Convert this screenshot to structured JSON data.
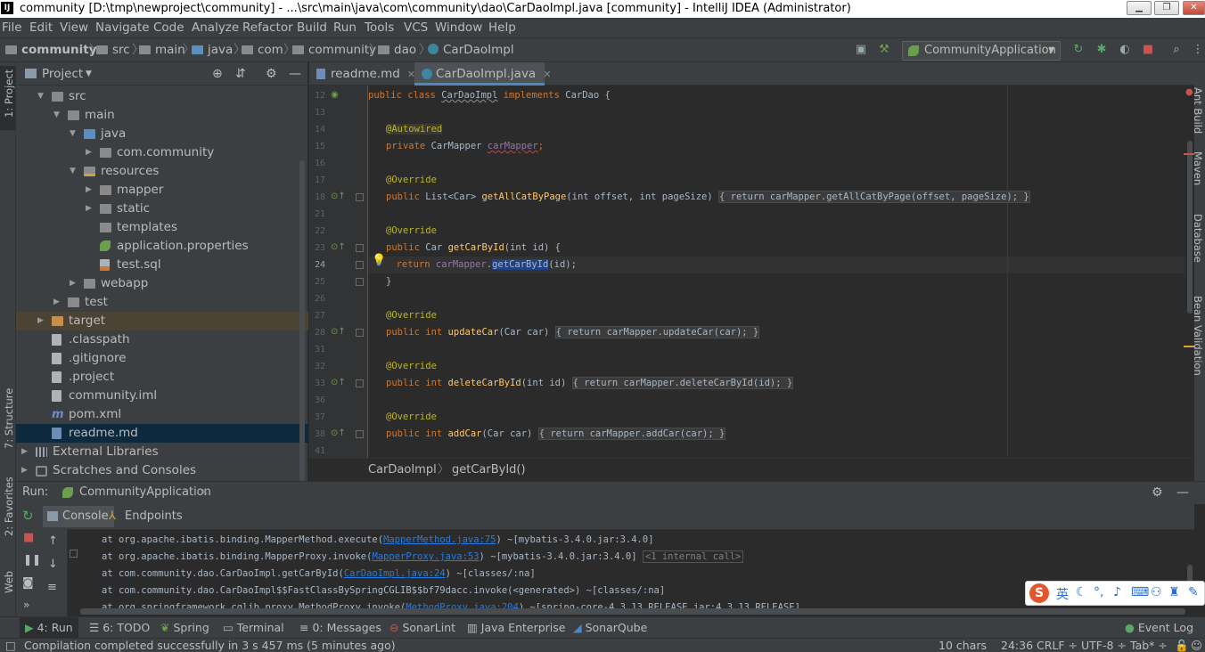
{
  "window": {
    "title": "community [D:\\tmp\\newproject\\community] - ...\\src\\main\\java\\com\\community\\dao\\CarDaoImpl.java [community] - IntelliJ IDEA (Administrator)",
    "app_icon": "IJ"
  },
  "menu": [
    "File",
    "Edit",
    "View",
    "Navigate",
    "Code",
    "Analyze",
    "Refactor",
    "Build",
    "Run",
    "Tools",
    "VCS",
    "Window",
    "Help"
  ],
  "breadcrumb": [
    "community",
    "src",
    "main",
    "java",
    "com",
    "community",
    "dao",
    "CarDaoImpl"
  ],
  "run_config": "CommunityApplication",
  "left_stripe": {
    "project": "1: Project",
    "structure": "7: Structure",
    "favorites": "2: Favorites",
    "web": "Web"
  },
  "right_stripe": {
    "ant": "Ant Build",
    "maven": "Maven",
    "database": "Database",
    "bean": "Bean Validation"
  },
  "project_panel": {
    "title": "Project",
    "tree": [
      {
        "label": "src",
        "depth": 1,
        "arrow": "open",
        "icon": "grey"
      },
      {
        "label": "main",
        "depth": 2,
        "arrow": "open",
        "icon": "grey"
      },
      {
        "label": "java",
        "depth": 3,
        "arrow": "open",
        "icon": "blue"
      },
      {
        "label": "com.community",
        "depth": 4,
        "arrow": "closed",
        "icon": "grey"
      },
      {
        "label": "resources",
        "depth": 3,
        "arrow": "open",
        "icon": "res"
      },
      {
        "label": "mapper",
        "depth": 4,
        "arrow": "closed",
        "icon": "grey"
      },
      {
        "label": "static",
        "depth": 4,
        "arrow": "closed",
        "icon": "grey"
      },
      {
        "label": "templates",
        "depth": 4,
        "arrow": "none",
        "icon": "grey"
      },
      {
        "label": "application.properties",
        "depth": 4,
        "arrow": "none",
        "icon": "leaf"
      },
      {
        "label": "test.sql",
        "depth": 4,
        "arrow": "none",
        "icon": "sql"
      },
      {
        "label": "webapp",
        "depth": 3,
        "arrow": "closed",
        "icon": "grey"
      },
      {
        "label": "test",
        "depth": 2,
        "arrow": "closed",
        "icon": "grey"
      },
      {
        "label": "target",
        "depth": 1,
        "arrow": "closed",
        "icon": "orange",
        "state": "hl"
      },
      {
        "label": ".classpath",
        "depth": 1,
        "arrow": "none",
        "icon": "file"
      },
      {
        "label": ".gitignore",
        "depth": 1,
        "arrow": "none",
        "icon": "file"
      },
      {
        "label": ".project",
        "depth": 1,
        "arrow": "none",
        "icon": "file"
      },
      {
        "label": "community.iml",
        "depth": 1,
        "arrow": "none",
        "icon": "file"
      },
      {
        "label": "pom.xml",
        "depth": 1,
        "arrow": "none",
        "icon": "m"
      },
      {
        "label": "readme.md",
        "depth": 1,
        "arrow": "none",
        "icon": "md",
        "state": "sel"
      },
      {
        "label": "External Libraries",
        "depth": 0,
        "arrow": "closed",
        "icon": "lib"
      },
      {
        "label": "Scratches and Consoles",
        "depth": 0,
        "arrow": "closed",
        "icon": "scratch"
      }
    ]
  },
  "editor": {
    "tabs": [
      {
        "label": "readme.md",
        "active": false
      },
      {
        "label": "CarDaoImpl.java",
        "active": true
      }
    ],
    "line_numbers": [
      "12",
      "13",
      "14",
      "15",
      "16",
      "17",
      "18",
      "21",
      "22",
      "23",
      "24",
      "25",
      "26",
      "27",
      "28",
      "31",
      "32",
      "33",
      "36",
      "37",
      "38",
      "41"
    ],
    "current_line": "24",
    "code": {
      "class_decl": {
        "k1": "public class ",
        "name": "CarDaoImpl",
        "k2": " implements ",
        "iface": "CarDao {"
      },
      "autowired": "@Autowired",
      "field": {
        "k": "private ",
        "type": "CarMapper ",
        "name": "carMapper",
        "end": ";"
      },
      "override": "@Override",
      "m1": {
        "k": "public ",
        "ret": "List<Car> ",
        "name": "getAllCatByPage",
        "params": "(int offset, int pageSize) ",
        "body": "{ return carMapper.getAllCatByPage(offset, pageSize); }"
      },
      "m2": {
        "k": "public ",
        "ret": "Car ",
        "name": "getCarById",
        "params": "(int id) {"
      },
      "m2_body": {
        "k": "return ",
        "field": "carMapper",
        "dot": ".",
        "call": "getCarById",
        "args": "(id);"
      },
      "close_brace": "}",
      "m3": {
        "k": "public int ",
        "name": "updateCar",
        "params": "(Car car) ",
        "body": "{ return carMapper.updateCar(car); }"
      },
      "m4": {
        "k": "public int ",
        "name": "deleteCarById",
        "params": "(int id) ",
        "body": "{ return carMapper.deleteCarById(id); }"
      },
      "m5": {
        "k": "public int ",
        "name": "addCar",
        "params": "(Car car) ",
        "body": "{ return carMapper.addCar(car); }"
      }
    },
    "breadcrumb": [
      "CarDaoImpl",
      "getCarById()"
    ]
  },
  "run_panel": {
    "label": "Run:",
    "config": "CommunityApplication",
    "tabs": [
      "Console",
      "Endpoints"
    ],
    "lines": [
      {
        "pre": "at org.apache.ibatis.binding.MapperMethod.execute(",
        "link": "MapperMethod.java:75",
        "post": ") ~[mybatis-3.4.0.jar:3.4.0]",
        "extra": ""
      },
      {
        "pre": "at org.apache.ibatis.binding.MapperProxy.invoke(",
        "link": "MapperProxy.java:53",
        "post": ") ~[mybatis-3.4.0.jar:3.4.0] ",
        "extra": "<1 internal call>"
      },
      {
        "pre": "at com.community.dao.CarDaoImpl.getCarById(",
        "link": "CarDaoImpl.java:24",
        "post": ") ~[classes/:na]",
        "extra": ""
      },
      {
        "pre": "at com.community.dao.CarDaoImpl$$FastClassBySpringCGLIB$$bf79dacc.invoke(<generated>) ~[classes/:na]",
        "link": "",
        "post": "",
        "extra": ""
      },
      {
        "pre": "at org.springframework.cglib.proxy.MethodProxy.invoke(",
        "link": "MethodProxy.java:204",
        "post": ") ~[spring-core-4.3.13.RELEASE.jar:4.3.13.RELEASE]",
        "extra": ""
      }
    ]
  },
  "bottom_tabs": [
    "4: Run",
    "6: TODO",
    "Spring",
    "Terminal",
    "0: Messages",
    "SonarLint",
    "Java Enterprise",
    "SonarQube"
  ],
  "event_log": "Event Log",
  "status": {
    "message": "Compilation completed successfully in 3 s 457 ms (5 minutes ago)",
    "chars": "10 chars",
    "position": "24:36",
    "line_sep": "CRLF ÷",
    "encoding": "UTF-8 ÷",
    "indent": "Tab* ÷"
  },
  "ime": {
    "lang": "英"
  }
}
